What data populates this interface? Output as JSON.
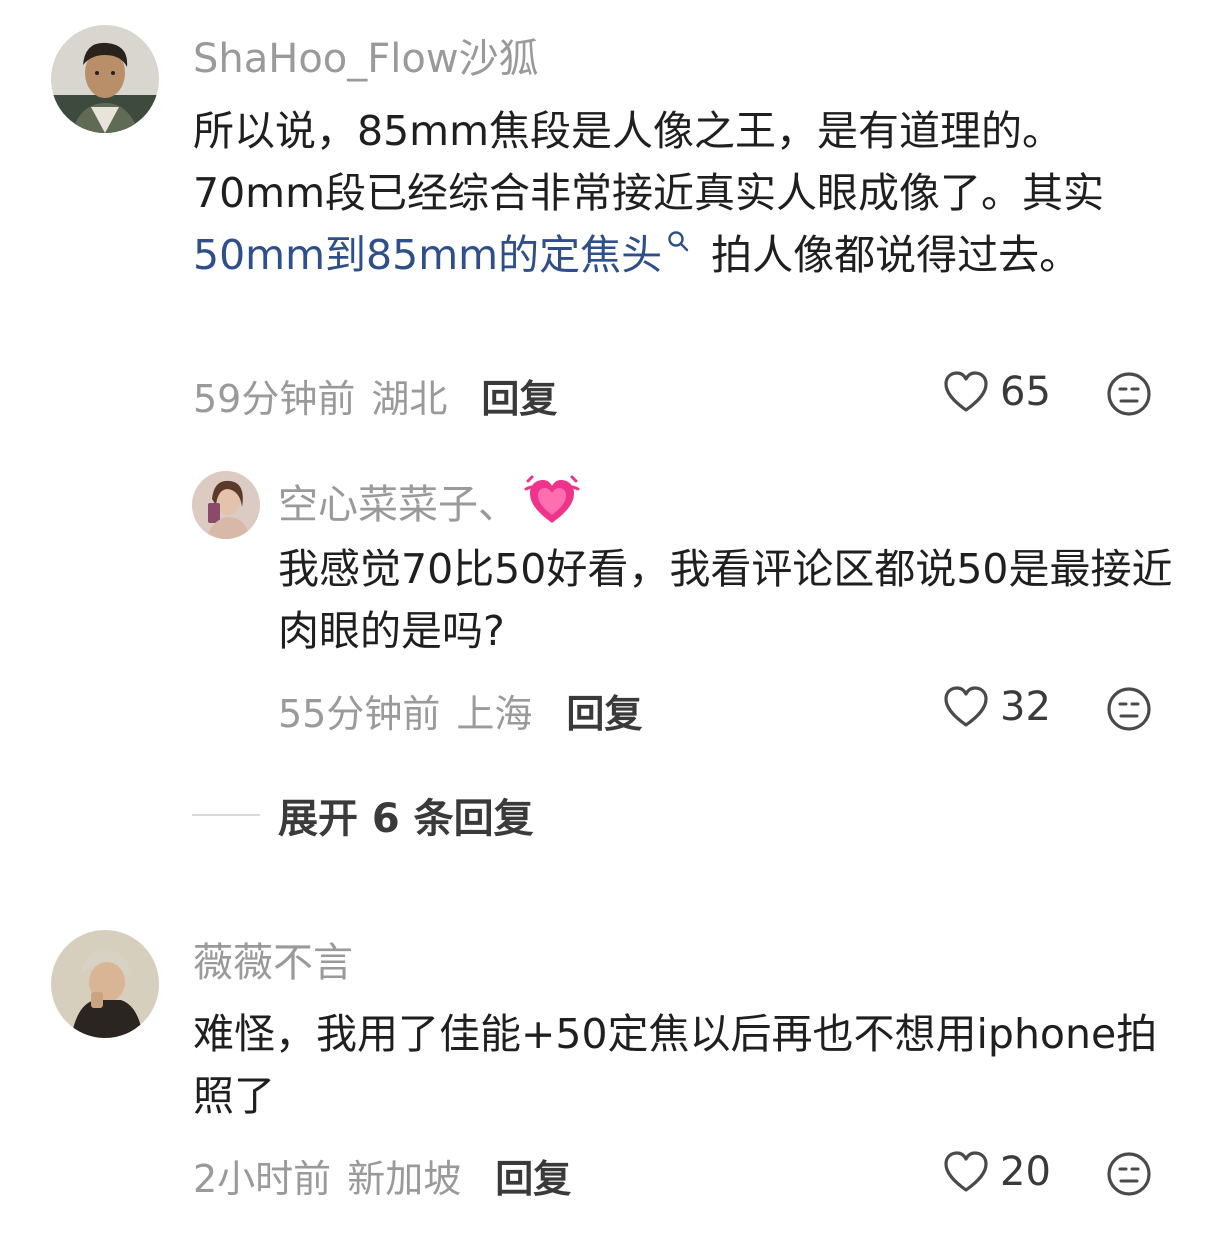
{
  "comments": [
    {
      "username": "ShaHoo_Flow沙狐",
      "text_before": "所以说，85mm焦段是人像之王，是有道理的。70mm段已经综合非常接近真实人眼成像了。其实 ",
      "link_text": "50mm到85mm的定焦头",
      "text_after": " 拍人像都说得过去。",
      "time": "59分钟前",
      "location": "湖北",
      "reply_label": "回复",
      "likes": "65"
    },
    {
      "username": "薇薇不言",
      "text": "难怪，我用了佳能+50定焦以后再也不想用iphone拍照了",
      "time": "2小时前",
      "location": "新加坡",
      "reply_label": "回复",
      "likes": "20"
    }
  ],
  "reply": {
    "username": "空心菜菜子、",
    "emoji": "beating-heart-emoji",
    "text": "我感觉70比50好看，我看评论区都说50是最接近肉眼的是吗?",
    "time": "55分钟前",
    "location": "上海",
    "reply_label": "回复",
    "likes": "32"
  },
  "expand_replies": "展开 6 条回复",
  "icons": [
    "heart-icon",
    "dislike-face-icon",
    "search-icon"
  ],
  "colors": {
    "username": "#9a9a9a",
    "link": "#2f4f8a",
    "text": "#1f1f1f"
  }
}
